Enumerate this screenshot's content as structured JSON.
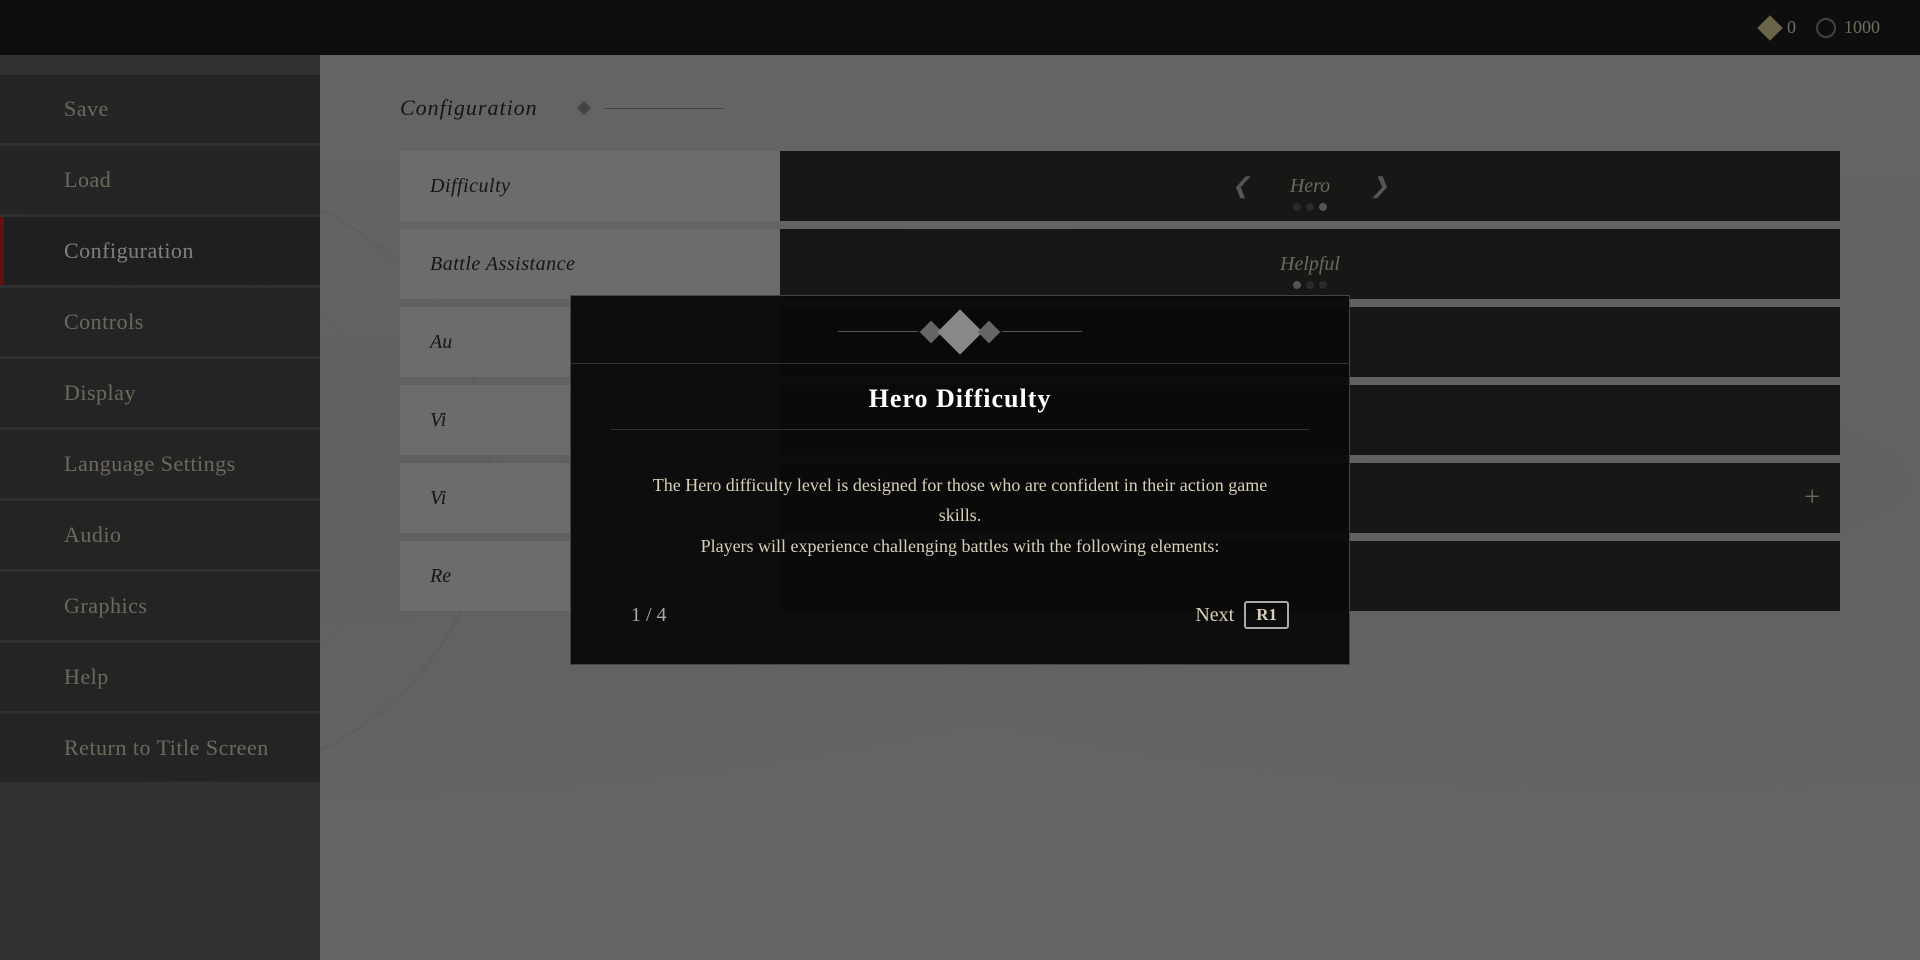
{
  "topbar": {
    "currency1_value": "0",
    "currency2_value": "1000"
  },
  "sidebar": {
    "items": [
      {
        "label": "Save",
        "active": false
      },
      {
        "label": "Load",
        "active": false
      },
      {
        "label": "Configuration",
        "active": true
      },
      {
        "label": "Controls",
        "active": false
      },
      {
        "label": "Display",
        "active": false
      },
      {
        "label": "Language Settings",
        "active": false
      },
      {
        "label": "Audio",
        "active": false
      },
      {
        "label": "Graphics",
        "active": false
      },
      {
        "label": "Help",
        "active": false
      },
      {
        "label": "Return to Title Screen",
        "active": false
      }
    ]
  },
  "main": {
    "title": "Configuration",
    "rows": [
      {
        "label": "Difficulty",
        "value": "Hero",
        "type": "selector",
        "dots": [
          false,
          false,
          true
        ]
      },
      {
        "label": "Battle Assistance",
        "value": "Helpful",
        "type": "plain",
        "dots": [
          true,
          false,
          false
        ]
      },
      {
        "label": "Au",
        "value": "",
        "type": "partial"
      },
      {
        "label": "Vi",
        "value": "",
        "type": "partial"
      },
      {
        "label": "Vi",
        "value": "+",
        "type": "partial-plus"
      },
      {
        "label": "Re",
        "value": "",
        "type": "partial"
      }
    ]
  },
  "modal": {
    "title": "Hero Difficulty",
    "body": "The Hero difficulty level is designed for those who are confident in their action game skills.\nPlayers will experience challenging battles with the following elements:",
    "page_current": "1",
    "page_total": "4",
    "page_label": "1 / 4",
    "next_label": "Next",
    "next_button": "R1"
  }
}
